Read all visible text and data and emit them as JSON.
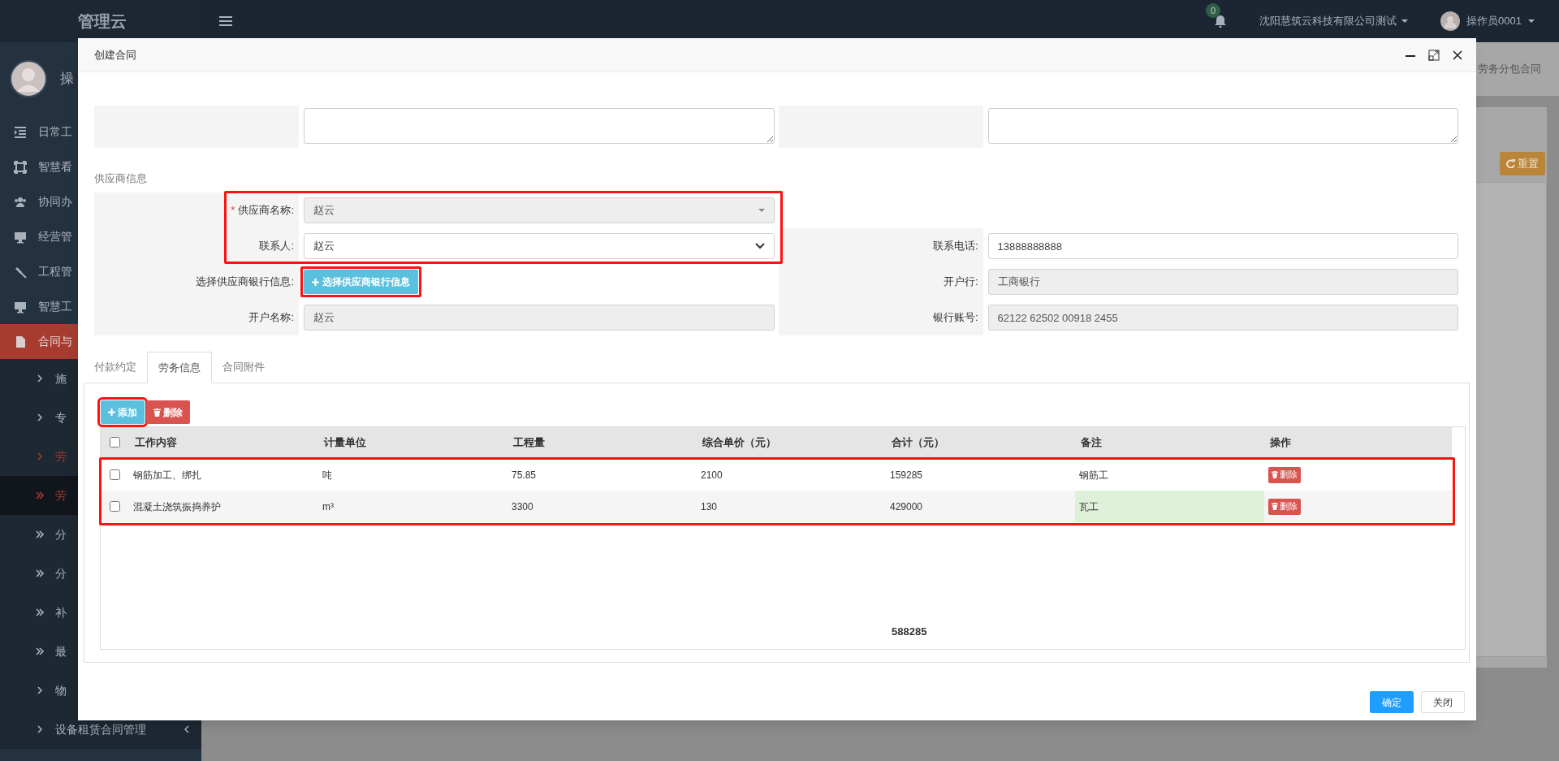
{
  "topbar": {
    "notifications": "0",
    "company": "沈阳慧筑云科技有限公司测试",
    "user": "操作员0001"
  },
  "sidebar": {
    "logo": "管理云",
    "user": "操",
    "menu": [
      {
        "label": "日常工",
        "selected": false
      },
      {
        "label": "智慧看",
        "selected": false
      },
      {
        "label": "协同办",
        "selected": false
      },
      {
        "label": "经营管",
        "selected": false
      },
      {
        "label": "工程管",
        "selected": false
      },
      {
        "label": "智慧工",
        "selected": false
      },
      {
        "label": "合同与",
        "selected": true,
        "expanded": true,
        "children": [
          {
            "label": "施",
            "kind": "chevron",
            "active": false,
            "selected": false,
            "caret": false
          },
          {
            "label": "专",
            "kind": "chevron",
            "active": false,
            "selected": false,
            "caret": false
          },
          {
            "label": "劳",
            "kind": "chevron",
            "active": true,
            "selected": false,
            "caret": false
          },
          {
            "label": "劳",
            "kind": "double",
            "active": true,
            "selected": true,
            "caret": false
          },
          {
            "label": "分",
            "kind": "double",
            "active": false,
            "selected": false,
            "caret": false
          },
          {
            "label": "分",
            "kind": "double",
            "active": false,
            "selected": false,
            "caret": false
          },
          {
            "label": "补",
            "kind": "double",
            "active": false,
            "selected": false,
            "caret": false
          },
          {
            "label": "最",
            "kind": "double",
            "active": false,
            "selected": false,
            "caret": false
          },
          {
            "label": "物",
            "kind": "chevron",
            "active": false,
            "selected": false,
            "caret": false
          },
          {
            "label": "设备租赁合同管理",
            "kind": "chevron",
            "active": false,
            "selected": false,
            "caret": true
          }
        ]
      }
    ]
  },
  "background": {
    "page_tab": "劳务分包合同",
    "reset_button": "重置"
  },
  "modal": {
    "title": "创建合同",
    "upper_fields": [
      {
        "kind": "textarea"
      },
      {
        "kind": "textarea"
      }
    ],
    "supplier": {
      "title": "供应商信息",
      "left_fields": [
        {
          "label": "供应商名称:",
          "required_mark": "*",
          "kind": "select",
          "value": "赵云",
          "disabled": true,
          "highlighted": true
        },
        {
          "label": "联系人:",
          "kind": "select",
          "value": "赵云",
          "disabled": false,
          "highlighted": true
        },
        {
          "label": "选择供应商银行信息:",
          "kind": "button",
          "value": "选择供应商银行信息",
          "highlighted": true
        },
        {
          "label": "开户名称:",
          "kind": "input",
          "value": "赵云",
          "disabled": true,
          "highlighted": false
        }
      ],
      "right_fields": [
        {
          "label": "联系电话:",
          "kind": "input",
          "value": "13888888888",
          "disabled": false,
          "highlighted": false
        },
        {
          "label": "开户行:",
          "kind": "input",
          "value": "工商银行",
          "disabled": true,
          "highlighted": false
        },
        {
          "label": "银行账号:",
          "kind": "input",
          "value": "62122 62502 00918 2455",
          "disabled": true,
          "highlighted": false
        }
      ]
    },
    "tabs": [
      {
        "label": "付款约定",
        "selected": false
      },
      {
        "label": "劳务信息",
        "selected": true
      },
      {
        "label": "合同附件",
        "selected": false
      }
    ],
    "toolbar": [
      {
        "kind": "add",
        "label": "添加",
        "highlighted": true
      },
      {
        "kind": "delete",
        "label": "删除",
        "highlighted": false
      }
    ],
    "table": {
      "columns": [
        "工作内容",
        "计量单位",
        "工程量",
        "综合单价（元）",
        "合计（元）",
        "备注",
        "操作"
      ],
      "select_all_checked": false,
      "rows_highlighted": true,
      "rows": [
        {
          "checked": false,
          "cells": [
            "钢筋加工、绑扎",
            "吨",
            "75.85",
            "2100",
            "159285",
            "钢筋工"
          ],
          "action": "删除",
          "remark_editing": false
        },
        {
          "checked": false,
          "cells": [
            "混凝土浇筑振捣养护",
            "m³",
            "3300",
            "130",
            "429000",
            "瓦工"
          ],
          "action": "删除",
          "remark_editing": true
        }
      ],
      "total": "588285"
    },
    "buttons": [
      {
        "kind": "primary",
        "label": "确定"
      },
      {
        "kind": "default",
        "label": "关闭"
      }
    ]
  }
}
